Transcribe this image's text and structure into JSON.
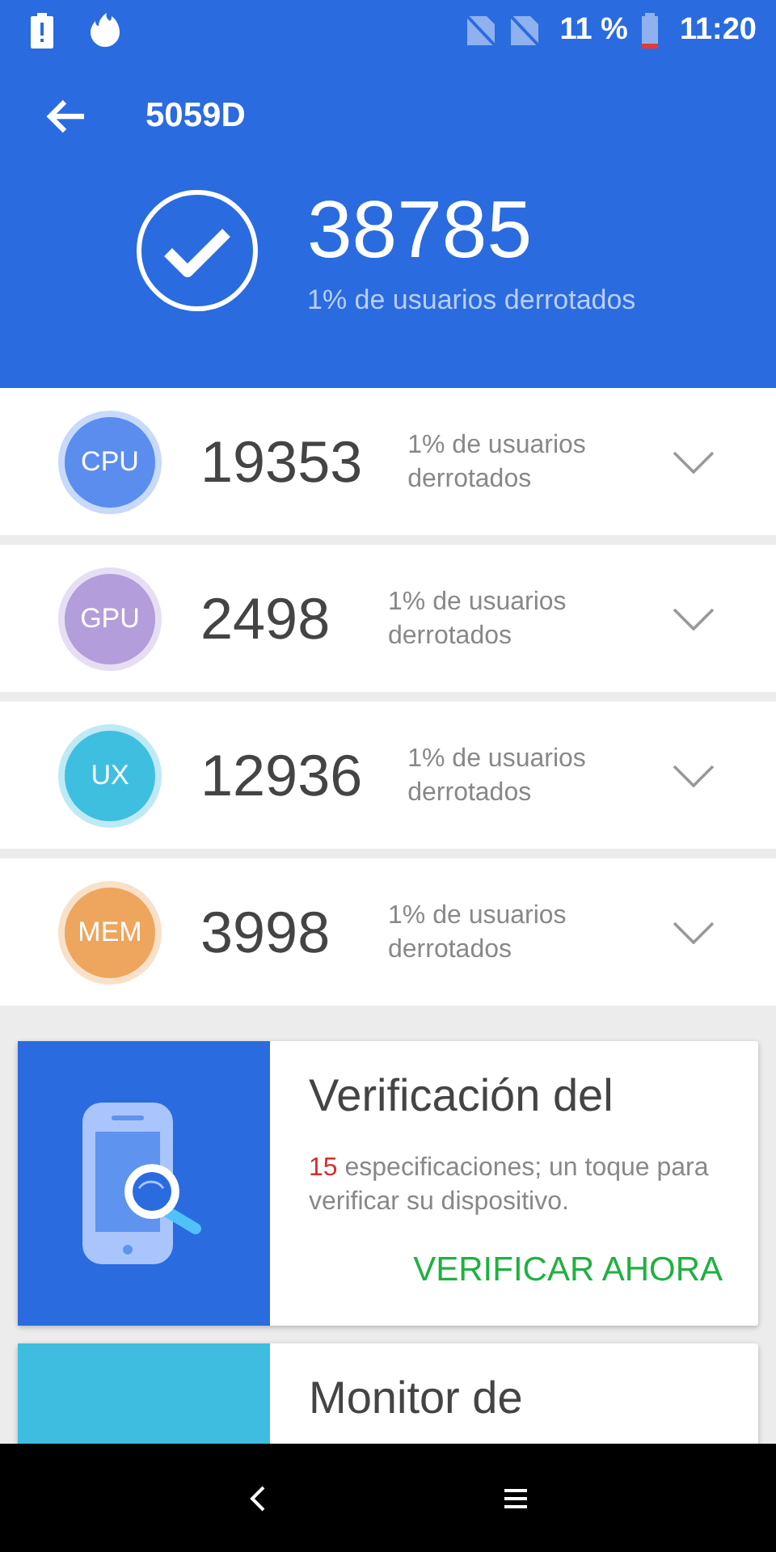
{
  "status_bar": {
    "battery_percent": "11 %",
    "time": "11:20"
  },
  "header": {
    "title": "5059D",
    "total_score": "38785",
    "total_caption": "1% de usuarios derrotados"
  },
  "categories": [
    {
      "label": "CPU",
      "score": "19353",
      "caption": "1% de usuarios derrotados",
      "color": "#5b8def"
    },
    {
      "label": "GPU",
      "score": "2498",
      "caption": "1% de usuarios derrotados",
      "color": "#b39ddb"
    },
    {
      "label": "UX",
      "score": "12936",
      "caption": "1% de usuarios derrotados",
      "color": "#3fbfe0"
    },
    {
      "label": "MEM",
      "score": "3998",
      "caption": "1% de usuarios derrotados",
      "color": "#eea55e"
    }
  ],
  "cards": [
    {
      "kind": "verify",
      "color": "#2a6be0",
      "title": "Verificación del",
      "count": "15",
      "description": "especificaciones; un toque para verificar su dispositivo.",
      "action": "VERIFICAR AHORA"
    },
    {
      "kind": "monitor",
      "color": "#3fbde0",
      "title": "Monitor de"
    }
  ]
}
